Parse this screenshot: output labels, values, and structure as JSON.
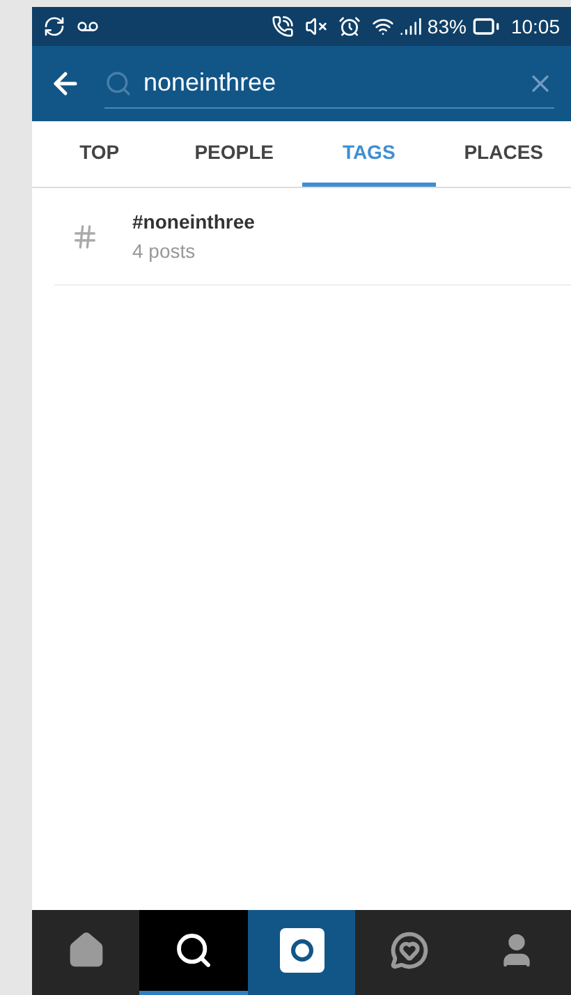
{
  "status_bar": {
    "battery": "83%",
    "time": "10:05"
  },
  "search": {
    "value": "noneinthree"
  },
  "tabs": [
    {
      "label": "TOP",
      "selected": false
    },
    {
      "label": "PEOPLE",
      "selected": false
    },
    {
      "label": "TAGS",
      "selected": true
    },
    {
      "label": "PLACES",
      "selected": false
    }
  ],
  "results": [
    {
      "title": "#noneinthree",
      "subtitle": "4 posts"
    }
  ],
  "bottom_nav": [
    {
      "kind": "home",
      "selected": false
    },
    {
      "kind": "search",
      "selected": true
    },
    {
      "kind": "camera",
      "selected": false
    },
    {
      "kind": "activity",
      "selected": false
    },
    {
      "kind": "profile",
      "selected": false
    }
  ]
}
